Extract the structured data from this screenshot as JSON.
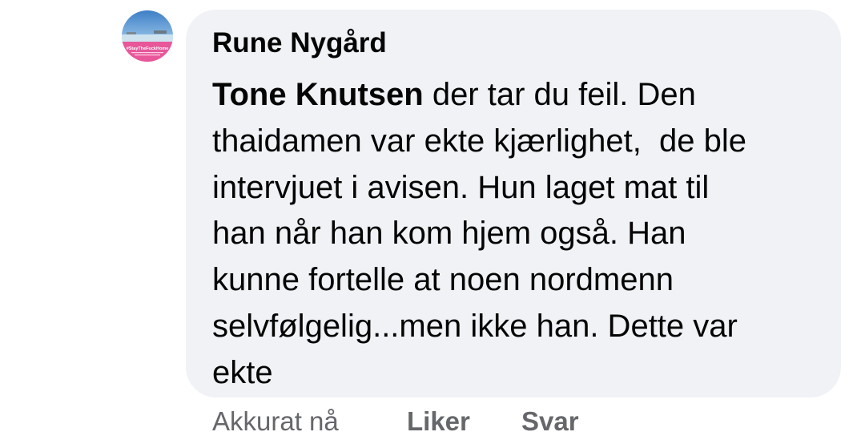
{
  "comment": {
    "avatar": {
      "icon": "profile-picture-icon",
      "frame_text": "#StayTheFuckHome"
    },
    "author": "Rune Nygård",
    "mention": "Tone Knutsen",
    "lines": [
      " der tar du feil. Den",
      "thaidamen var ekte kjærlighet,  de ble",
      "intervjuet i avisen. Hun laget mat til",
      "han når han kom hjem også. Han",
      "kunne fortelle at noen nordmenn",
      "selvfølgelig...men ikke han. Dette var",
      "ekte"
    ],
    "bubble_color": "#f0f2f5",
    "frame_color": "#e8579a"
  },
  "actions": {
    "timestamp": "Akkurat nå",
    "like_label": "Liker",
    "reply_label": "Svar"
  }
}
